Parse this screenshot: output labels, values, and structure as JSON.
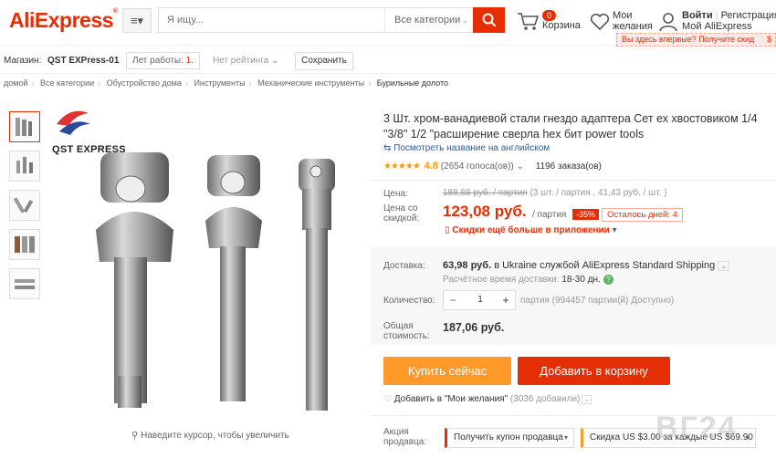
{
  "header": {
    "logo": "AliExpress",
    "search_placeholder": "Я ищу...",
    "search_category": "Все категории",
    "cart_count": "0",
    "cart_label": "Корзина",
    "wishlist_line1": "Мои",
    "wishlist_line2": "желания",
    "signin": "Войти",
    "register": "Регистрация",
    "my_account": "Мой AliExpress",
    "first_time_tip": "Вы здесь впервые? Получите скид",
    "tip_icon": "$"
  },
  "store": {
    "label": "Магазин:",
    "name": "QST EXPress-01",
    "years_label": "Лет работы:",
    "years_value": "1",
    "rating": "Нет рейтинга",
    "save": "Сохранить"
  },
  "breadcrumb": [
    "домой",
    "Все категории",
    "Обустройство дома",
    "Инструменты",
    "Механические инструменты",
    "Бурильные долото"
  ],
  "gallery": {
    "brand_text": "QST EXPRESS",
    "zoom_hint": "Наведите курсор, чтобы увеличить"
  },
  "product": {
    "title": "3 Шт. хром-ванадиевой стали гнездо адаптера Сет ех хвостовиком 1/4 \"3/8\" 1/2 \"расширение сверла hex бит power tools",
    "translate_link": "Посмотреть название на английском",
    "rating_stars": "★★★★★",
    "rating_score": "4.8",
    "votes": "(2654 голоса(ов))",
    "orders": "1196 заказа(ов)",
    "price_label": "Цена:",
    "old_price": "188,88 руб. / партия",
    "old_price_detail": "(3 шт. / партия , 41,43 руб. / шт. )",
    "discount_price_label_1": "Цена со",
    "discount_price_label_2": "скидкой:",
    "new_price": "123,08 руб.",
    "per_lot": "/ партия",
    "discount_pct": "-35%",
    "days_left": "Осталось дней: 4",
    "app_discount": "Скидки ещё больше в приложении",
    "shipping_label": "Доставка:",
    "shipping_price": "63,98 руб.",
    "shipping_text": "в Ukraine службой AliExpress Standard Shipping",
    "delivery_time_label": "Расчётное время доставки:",
    "delivery_time": "18-30",
    "delivery_unit": "дн.",
    "qty_label": "Количество:",
    "qty_value": "1",
    "qty_available": "партия (994457 партии(й) Доступно)",
    "total_label_1": "Общая",
    "total_label_2": "стоимость:",
    "total_value": "187,06 руб.",
    "buy_now": "Купить сейчас",
    "add_to_cart": "Добавить в корзину",
    "add_wishlist": "Добавить в \"Мои желания\"",
    "wishlist_count": "(3036 добавили)",
    "promo_label_1": "Акция",
    "promo_label_2": "продавца:",
    "coupon": "Получить купон продавца",
    "store_discount": "Скидка US $3.00 за каждые US $69.90"
  },
  "watermark": "ВГ24",
  "colors": {
    "brand": "#e62e04",
    "buy": "#ff9a2a",
    "link": "#2e5b8c",
    "star": "#ff9900"
  }
}
